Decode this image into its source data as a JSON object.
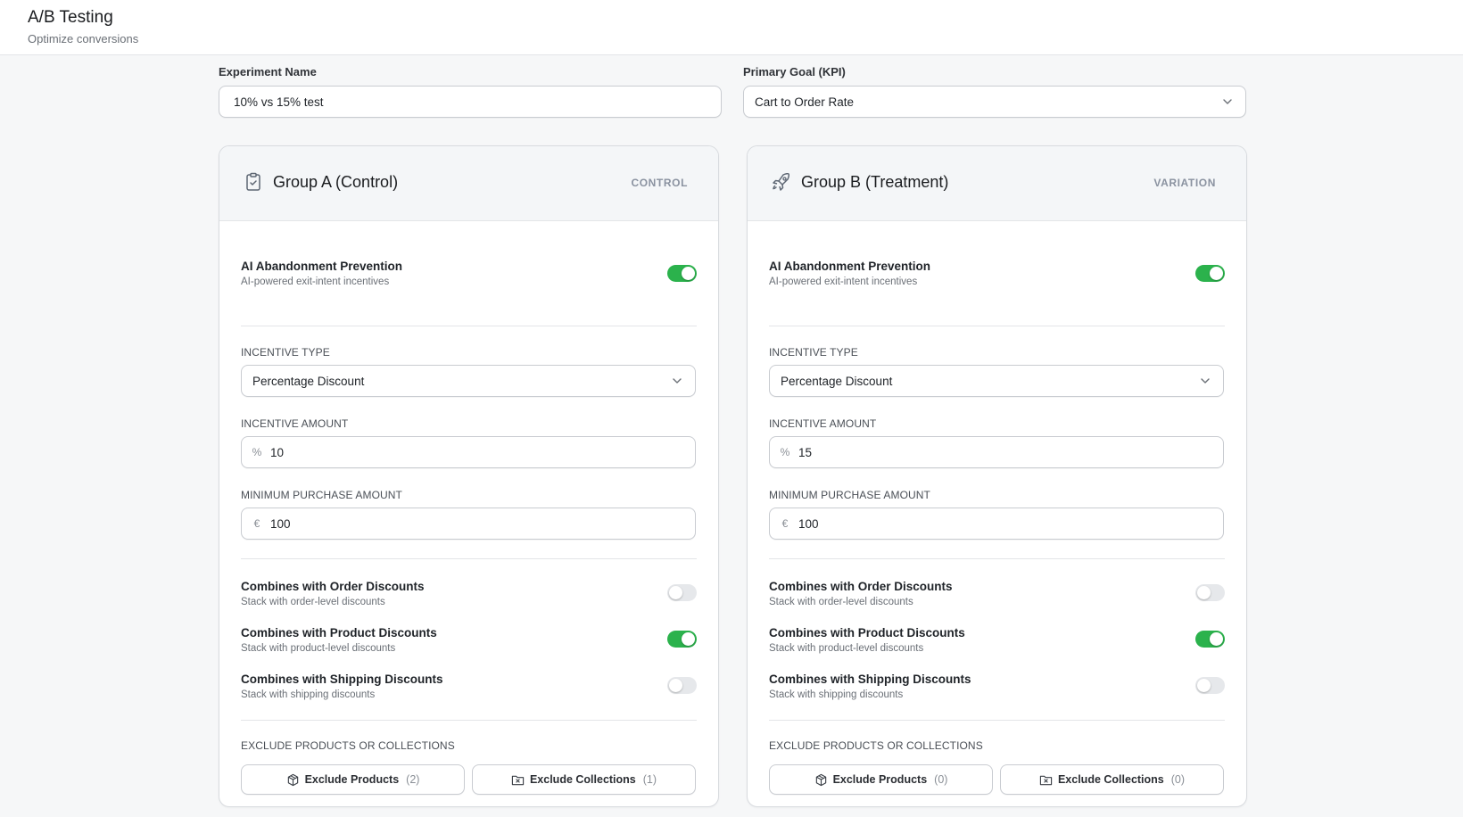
{
  "app": {
    "title": "A/B Testing",
    "subtitle": "Optimize conversions"
  },
  "experiment": {
    "name_label": "Experiment Name",
    "name_value": "10% vs 15% test",
    "goal_label": "Primary Goal (KPI)",
    "goal_value": "Cart to Order Rate"
  },
  "groups": [
    {
      "title": "Group A (Control)",
      "tag": "CONTROL",
      "icon": "clipboard-check-icon",
      "ai_title": "AI Abandonment Prevention",
      "ai_sub": "AI-powered exit-intent incentives",
      "ai_on": true,
      "incentive_type_label": "INCENTIVE TYPE",
      "incentive_type_value": "Percentage Discount",
      "incentive_amount_label": "INCENTIVE AMOUNT",
      "incentive_amount_prefix": "%",
      "incentive_amount_value": "10",
      "min_purchase_label": "MINIMUM PURCHASE AMOUNT",
      "min_purchase_prefix": "€",
      "min_purchase_value": "100",
      "combines": [
        {
          "title": "Combines with Order Discounts",
          "sub": "Stack with order-level discounts",
          "on": false
        },
        {
          "title": "Combines with Product Discounts",
          "sub": "Stack with product-level discounts",
          "on": true
        },
        {
          "title": "Combines with Shipping Discounts",
          "sub": "Stack with shipping discounts",
          "on": false
        }
      ],
      "exclude_label": "EXCLUDE PRODUCTS OR COLLECTIONS",
      "exclude_products_label": "Exclude Products",
      "exclude_products_count": "(2)",
      "exclude_collections_label": "Exclude Collections",
      "exclude_collections_count": "(1)"
    },
    {
      "title": "Group B (Treatment)",
      "tag": "VARIATION",
      "icon": "rocket-icon",
      "ai_title": "AI Abandonment Prevention",
      "ai_sub": "AI-powered exit-intent incentives",
      "ai_on": true,
      "incentive_type_label": "INCENTIVE TYPE",
      "incentive_type_value": "Percentage Discount",
      "incentive_amount_label": "INCENTIVE AMOUNT",
      "incentive_amount_prefix": "%",
      "incentive_amount_value": "15",
      "min_purchase_label": "MINIMUM PURCHASE AMOUNT",
      "min_purchase_prefix": "€",
      "min_purchase_value": "100",
      "combines": [
        {
          "title": "Combines with Order Discounts",
          "sub": "Stack with order-level discounts",
          "on": false
        },
        {
          "title": "Combines with Product Discounts",
          "sub": "Stack with product-level discounts",
          "on": true
        },
        {
          "title": "Combines with Shipping Discounts",
          "sub": "Stack with shipping discounts",
          "on": false
        }
      ],
      "exclude_label": "EXCLUDE PRODUCTS OR COLLECTIONS",
      "exclude_products_label": "Exclude Products",
      "exclude_products_count": "(0)",
      "exclude_collections_label": "Exclude Collections",
      "exclude_collections_count": "(0)"
    }
  ],
  "colors": {
    "toggle_on": "#2bb24c",
    "toggle_off": "#e6e8eb",
    "tag": "#8a92a0"
  }
}
